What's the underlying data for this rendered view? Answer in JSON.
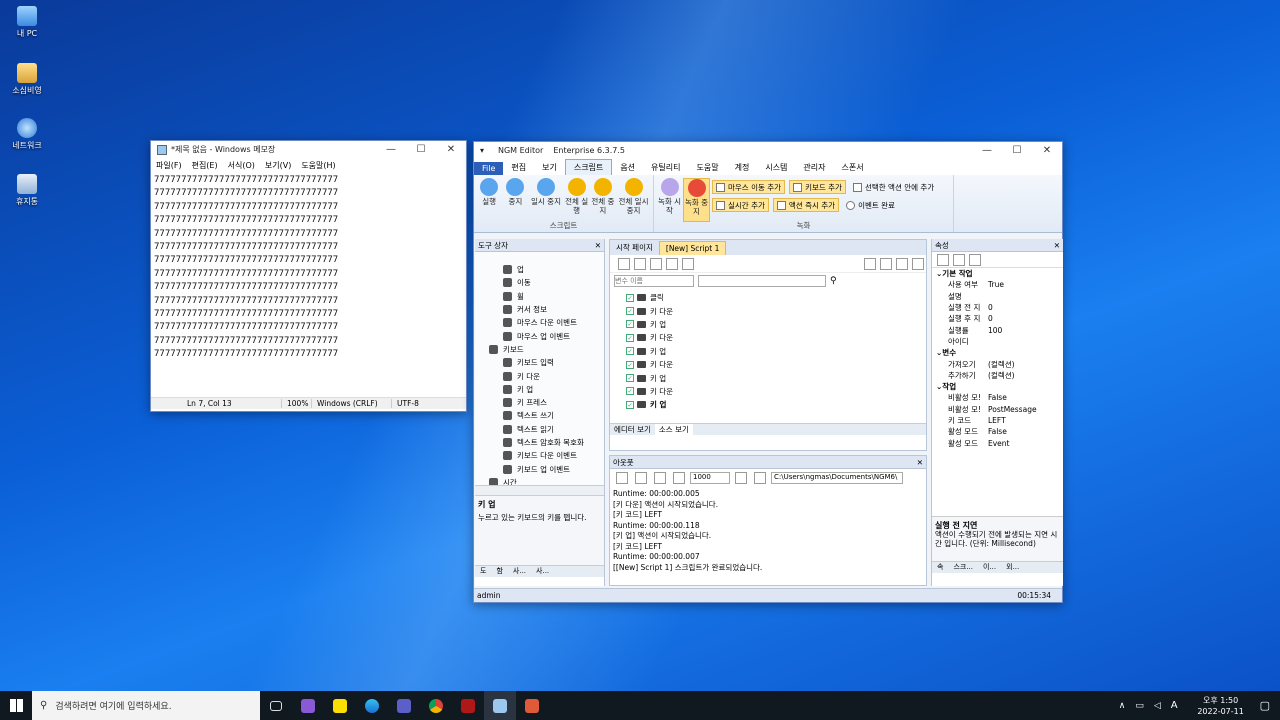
{
  "desktop": {
    "icons": [
      "내 PC",
      "소심비영",
      "네트워크",
      "휴지통"
    ]
  },
  "notepad": {
    "title": "*제목 없음 - Windows 메모장",
    "menu": [
      "파일(F)",
      "편집(E)",
      "서식(O)",
      "보기(V)",
      "도움말(H)"
    ],
    "line": "7777777777777777777777777777777777",
    "line_count": 14,
    "status": {
      "pos": "Ln 7, Col 13",
      "zoom": "100%",
      "eol": "Windows (CRLF)",
      "enc": "UTF-8"
    }
  },
  "ngm": {
    "title": "NGM Editor",
    "edition": "Enterprise 6.3.7.5",
    "tabs": [
      "File",
      "편집",
      "보기",
      "스크립트",
      "옵션",
      "유틸리티",
      "도움말",
      "계정",
      "시스템",
      "관리자",
      "스폰서"
    ],
    "script_buttons": [
      "실행",
      "중지",
      "일시 중지",
      "전체 실행",
      "전체 중지",
      "전체 일시 중지"
    ],
    "script_group": "스크립트",
    "record_buttons": [
      "녹화 시작",
      "녹화 중지"
    ],
    "record_chips": [
      "마우스 이동 추가",
      "키보드 추가",
      "선택한 액션 안에 추가",
      "실시간 추가",
      "액션 즉시 추가",
      "이벤트 완료"
    ],
    "record_group": "녹화",
    "toolbox": {
      "title": "도구 상자",
      "items": [
        "업",
        "이동",
        "휠",
        "커서 정보",
        "마우스 다운 이벤트",
        "마우스 업 이벤트",
        "키보드",
        "키보드 입력",
        "키 다운",
        "키 업",
        "키 프레스",
        "텍스트 쓰기",
        "텍스트 읽기",
        "텍스트 암호화 복호화",
        "키보드 다운 이벤트",
        "키보드 업 이벤트",
        "시간"
      ],
      "desc_title": "키 업",
      "desc": "누르고 있는 키보드의 키를 뗍니다.",
      "bottom_tabs": [
        "도",
        "함",
        "사...",
        "사..."
      ]
    },
    "doc_tabs": [
      "시작 페이지",
      "[New] Script 1"
    ],
    "var_placeholder": "변수 이름",
    "actions": [
      "클릭",
      "키 다운",
      "키 업",
      "키 다운",
      "키 업",
      "키 다운",
      "키 업",
      "키 다운",
      "키 업"
    ],
    "view_tabs": [
      "에디터 보기",
      "소스 보기"
    ],
    "output": {
      "title": "아웃풋",
      "count": "1000",
      "path": "C:\\Users\\ngmas\\Documents\\NGM6\\",
      "lines": [
        "Runtime: 00:00:00.005",
        "[키 다운] 액션이 시작되었습니다.",
        "[키 코드] LEFT",
        "Runtime: 00:00:00.118",
        "[키 업] 액션이 시작되었습니다.",
        "[키 코드] LEFT",
        "Runtime: 00:00:00.007",
        "[[New] Script 1] 스크립트가 완료되었습니다."
      ]
    },
    "props": {
      "title": "속성",
      "cat1": "기본 작업",
      "rows1": [
        [
          "사용 여부",
          "True"
        ],
        [
          "설명",
          ""
        ],
        [
          "실행 전 지",
          "0"
        ],
        [
          "실행 후 지",
          "0"
        ],
        [
          "실행률",
          "100"
        ],
        [
          "아이디",
          ""
        ]
      ],
      "cat2": "변수",
      "rows2": [
        [
          "가져오기",
          "(컬렉션)"
        ],
        [
          "추가하기",
          "(컬렉션)"
        ]
      ],
      "cat3": "작업",
      "rows3": [
        [
          "비활성 모!",
          "False"
        ],
        [
          "비활성 모!",
          "PostMessage"
        ],
        [
          "키 코드",
          "LEFT"
        ],
        [
          "활성 모드",
          "False"
        ],
        [
          "활성 모드",
          "Event"
        ]
      ],
      "desc_title": "실행 전 지연",
      "desc": "액션이 수행되기 전에 발생되는 지연 시간 입니다. (단위: Millisecond)",
      "bottom_tabs": [
        "속",
        "스크...",
        "이...",
        "외..."
      ]
    },
    "status_user": "admin",
    "status_time": "00:15:34"
  },
  "taskbar": {
    "search": "검색하려면 여기에 입력하세요.",
    "time": "오후 1:50",
    "date": "2022-07-11",
    "ime": "A"
  }
}
